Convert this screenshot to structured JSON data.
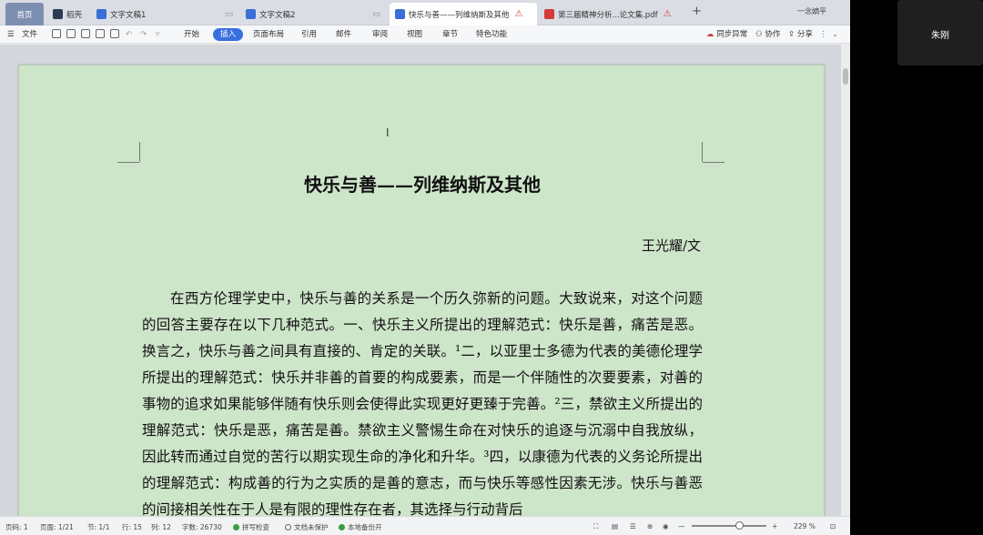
{
  "tabs": {
    "home": "首页",
    "daoke": "稻壳",
    "doc1": "文字文稿1",
    "doc2": "文字文稿2",
    "active": "快乐与善——列维纳斯及其他",
    "pdf": "第三届精神分析...论文集.pdf",
    "new_tab": "+",
    "user": "一念嫡平"
  },
  "menu": {
    "file": "文件",
    "items": [
      "开始",
      "插入",
      "页面布局",
      "引用",
      "邮件",
      "审阅",
      "视图",
      "章节",
      "特色功能"
    ],
    "sync": "同步异常",
    "collab": "协作",
    "share": "分享"
  },
  "document": {
    "title": "快乐与善——列维纳斯及其他",
    "author": "王光耀/文",
    "body": "在西方伦理学史中，快乐与善的关系是一个历久弥新的问题。大致说来，对这个问题的回答主要存在以下几种范式。一、快乐主义所提出的理解范式：快乐是善，痛苦是恶。换言之，快乐与善之间具有直接的、肯定的关联。¹二，以亚里士多德为代表的美德伦理学所提出的理解范式：快乐并非善的首要的构成要素，而是一个伴随性的次要要素，对善的事物的追求如果能够伴随有快乐则会使得此实现更好更臻于完善。²三，禁欲主义所提出的理解范式：快乐是恶，痛苦是善。禁欲主义警惕生命在对快乐的追逐与沉溺中自我放纵，因此转而通过自觉的苦行以期实现生命的净化和升华。³四，以康德为代表的义务论所提出的理解范式：构成善的行为之实质的是善的意志，而与快乐等感性因素无涉。快乐与善恶的间接相关性在于人是有限的理性存在者，其选择与行动背后"
  },
  "status": {
    "page": "页码: 1",
    "pages": "页面: 1/21",
    "section": "节: 1/1",
    "row": "行: 15",
    "col": "列: 12",
    "words": "字数: 26730",
    "spell": "拼写检查",
    "protect": "文档未保护",
    "backup": "本地备份开",
    "zoom": "229 %"
  },
  "meeting": {
    "participant": "朱刚"
  }
}
